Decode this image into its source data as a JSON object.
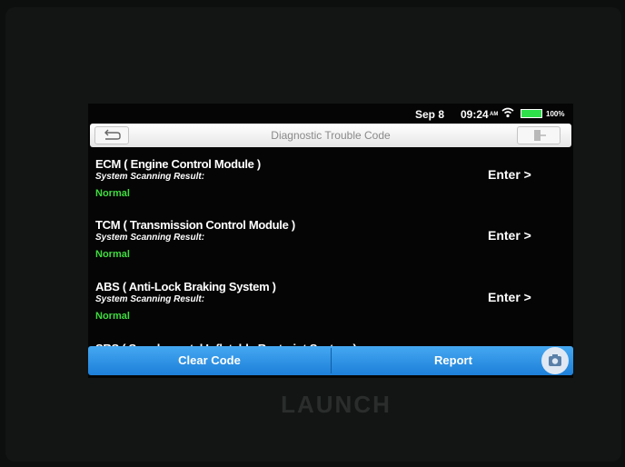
{
  "status": {
    "date": "Sep 8",
    "time": "09:24",
    "ampm": "AM",
    "battery": "100%",
    "wifi_icon": "wifi-icon",
    "battery_icon": "battery-icon",
    "battery_color": "#2ee14a"
  },
  "header": {
    "title": "Diagnostic Trouble Code",
    "back_icon": "back-arrow-icon",
    "exit_icon": "exit-icon"
  },
  "modules": [
    {
      "name": "ECM ( Engine Control Module )",
      "scan_label": "System Scanning Result:",
      "result": "Normal",
      "action": "Enter >"
    },
    {
      "name": "TCM ( Transmission Control Module )",
      "scan_label": "System Scanning Result:",
      "result": "Normal",
      "action": "Enter >"
    },
    {
      "name": "ABS ( Anti-Lock Braking System )",
      "scan_label": "System Scanning Result:",
      "result": "Normal",
      "action": "Enter >"
    },
    {
      "name": "SRS ( Supplemental Inflatable Restraint System )"
    }
  ],
  "footer": {
    "clear_label": "Clear Code",
    "report_label": "Report",
    "camera_icon": "camera-icon",
    "accent": "#2a90e4"
  },
  "device": {
    "brand": "LAUNCH"
  }
}
